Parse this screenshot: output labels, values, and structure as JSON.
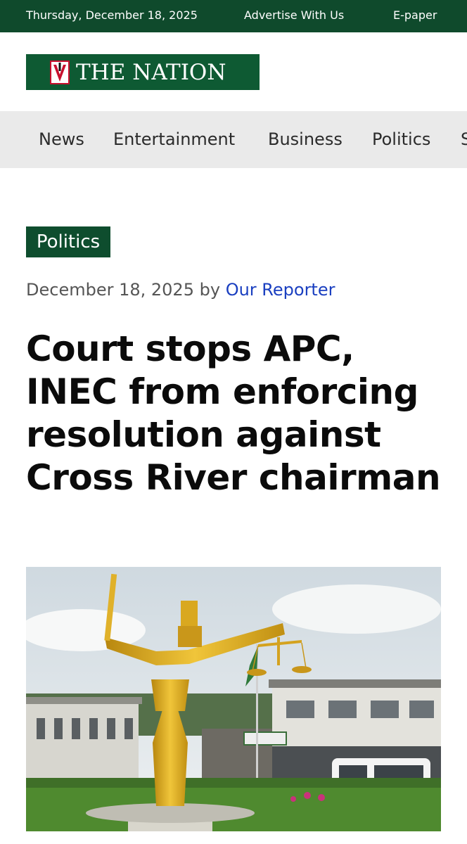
{
  "topbar": {
    "date": "Thursday, December 18, 2025",
    "advertise": "Advertise With Us",
    "epaper": "E-paper"
  },
  "logo": {
    "text": "THE NATION",
    "icon": "nation-emblem-icon"
  },
  "nav": {
    "items": [
      "News",
      "Entertainment",
      "Business",
      "Politics",
      "S"
    ]
  },
  "article": {
    "category": "Politics",
    "date": "December 18, 2025",
    "by": "by",
    "author": "Our Reporter",
    "headline": "Court stops APC, INEC from enforcing resolution against Cross River chairman",
    "image_alt": "Golden statue of justice in front of a court building"
  },
  "colors": {
    "brand_green": "#0e5a33",
    "topbar_green": "#0f4a2c",
    "author_blue": "#1a3fc0",
    "nav_bg": "#eaeaea"
  }
}
